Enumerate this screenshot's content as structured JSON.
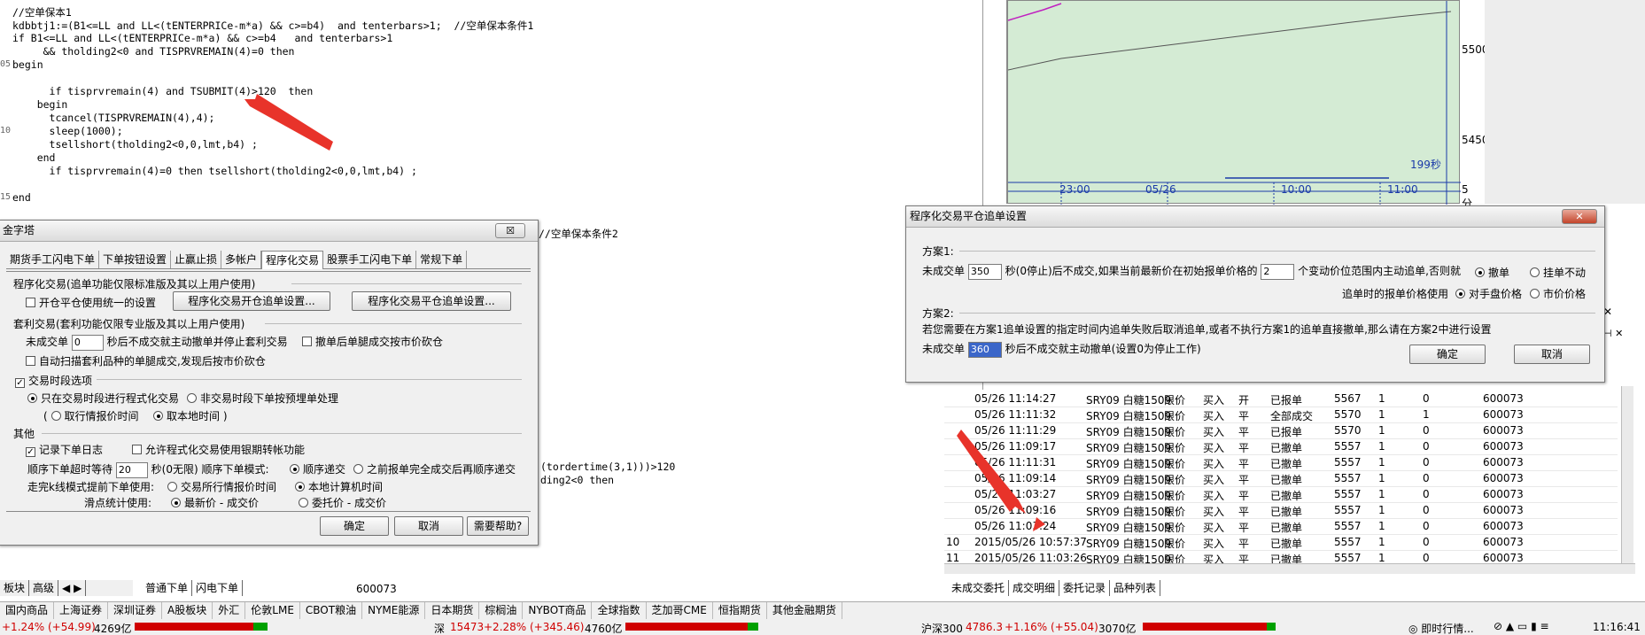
{
  "editor": {
    "lines": [
      {
        "no": "",
        "text": "//空单保本1",
        "cls": "cm"
      },
      {
        "no": "",
        "text": "kdbbtj1:=(B1<=LL and LL<(tENTERPRICe-m*a) && c>=b4)  and tenterbars>1;  //空单保本条件1",
        "cls": ""
      },
      {
        "no": "",
        "text": "if B1<=LL and LL<(tENTERPRICe-m*a) && c>=b4   and tenterbars>1",
        "cls": ""
      },
      {
        "no": "",
        "text": "     && tholding2<0 and TISPRVREMAIN(4)=0 then",
        "cls": ""
      },
      {
        "no": "05",
        "text": "begin",
        "cls": ""
      },
      {
        "no": "",
        "text": "",
        "cls": ""
      },
      {
        "no": "",
        "text": "      if tisprvremain(4) and TSUBMIT(4)>120  then",
        "cls": ""
      },
      {
        "no": "",
        "text": "    begin",
        "cls": ""
      },
      {
        "no": "",
        "text": "      tcancel(TISPRVREMAIN(4),4);",
        "cls": ""
      },
      {
        "no": "10",
        "text": "      sleep(1000);",
        "cls": ""
      },
      {
        "no": "",
        "text": "      tsellshort(tholding2<0,0,lmt,b4) ;",
        "cls": ""
      },
      {
        "no": "",
        "text": "    end",
        "cls": ""
      },
      {
        "no": "",
        "text": "      if tisprvremain(4)=0 then tsellshort(tholding2<0,0,lmt,b4) ;",
        "cls": ""
      },
      {
        "no": "",
        "text": "",
        "cls": ""
      },
      {
        "no": "15",
        "text": "end",
        "cls": ""
      }
    ],
    "fragment1": "//空单保本条件2",
    "fragment2": "(tordertime(3,1)))>120",
    "fragment3": "ding2<0 then"
  },
  "chart": {
    "y_labels": [
      "5500",
      "5450"
    ],
    "x_labels": [
      "23:00",
      "05/26",
      "10:00",
      "11:00"
    ],
    "period": "5分",
    "countdown": "199秒"
  },
  "dialog1": {
    "title": "金字塔",
    "close": "☒",
    "tabs": [
      "期货手工闪电下单",
      "下单按钮设置",
      "止赢止损",
      "多帐户",
      "程序化交易",
      "股票手工闪电下单",
      "常规下单"
    ],
    "active_tab": 4,
    "s1_title": "程序化交易(追单功能仅限标准版及其以上用户使用)",
    "s1_chk": "开仓平仓使用统一的设置",
    "s1_btn1": "程序化交易开仓追单设置...",
    "s1_btn2": "程序化交易平仓追单设置...",
    "s2_title": "套利交易(套利功能仅限专业版及其以上用户使用)",
    "s2_pre": "未成交单",
    "s2_val": "0",
    "s2_post": "秒后不成交就主动撤单并停止套利交易",
    "s2_chk2": "撤单后单腿成交按市价砍仓",
    "s2_chk3": "自动扫描套利品种的单腿成交,发现后按市价砍仓",
    "s3_chk": "交易时段选项",
    "s3_r1": "只在交易时段进行程式化交易",
    "s3_r2": "非交易时段下单按预埋单处理",
    "s3_r3": "取行情报价时间",
    "s3_r4": "取本地时间",
    "s4_title": "其他",
    "s4_chk1": "记录下单日志",
    "s4_chk2": "允许程式化交易使用银期转帐功能",
    "s4_wait_pre": "顺序下单超时等待",
    "s4_wait_val": "20",
    "s4_wait_post": "秒(0无限) 顺序下单模式:",
    "s4_mode1": "顺序递交",
    "s4_mode2": "之前报单完全成交后再顺序递交",
    "s4_adv_pre": "走完k线模式提前下单使用:",
    "s4_adv1": "交易所行情报价时间",
    "s4_adv2": "本地计算机时间",
    "s4_slip_pre": "滑点统计使用:",
    "s4_slip1": "最新价 - 成交价",
    "s4_slip2": "委托价 - 成交价",
    "ok": "确定",
    "cancel": "取消",
    "help": "需要帮助?"
  },
  "dialog2": {
    "title": "程序化交易平仓追单设置",
    "close": "✕",
    "p1_label": "方案1:",
    "p1_pre": "未成交单",
    "p1_val": "350",
    "p1_mid": "秒(0停止)后不成交,如果当前最新价在初始报单价格的",
    "p1_val2": "2",
    "p1_post": "个变动价位范围内主动追单,否则就",
    "p1_r1": "撤单",
    "p1_r2": "挂单不动",
    "p1_line2": "追单时的报单价格使用",
    "p1_r3": "对手盘价格",
    "p1_r4": "市价价格",
    "p2_label": "方案2:",
    "p2_desc": "若您需要在方案1追单设置的指定时间内追单失败后取消追单,或者不执行方案1的追单直接撤单,那么请在方案2中进行设置",
    "p2_pre": "未成交单",
    "p2_val": "360",
    "p2_post": "秒后不成交就主动撤单(设置0为停止工作)",
    "ok": "确定",
    "cancel": "取消"
  },
  "orders": [
    {
      "n": "",
      "time": "05/26 11:14:27",
      "contract": "SRY09 白糖1509",
      "type": "限价",
      "dir": "买入",
      "oc": "开",
      "status": "已报单",
      "price": "5567",
      "qty": "1",
      "filled": "0",
      "acct": "600073"
    },
    {
      "n": "",
      "time": "05/26 11:11:32",
      "contract": "SRY09 白糖1509",
      "type": "限价",
      "dir": "买入",
      "oc": "平",
      "status": "全部成交",
      "price": "5570",
      "qty": "1",
      "filled": "1",
      "acct": "600073"
    },
    {
      "n": "",
      "time": "05/26 11:11:29",
      "contract": "SRY09 白糖1509",
      "type": "限价",
      "dir": "买入",
      "oc": "平",
      "status": "已报单",
      "price": "5570",
      "qty": "1",
      "filled": "0",
      "acct": "600073"
    },
    {
      "n": "",
      "time": "05/26 11:09:17",
      "contract": "SRY09 白糖1509",
      "type": "限价",
      "dir": "买入",
      "oc": "平",
      "status": "已撤单",
      "price": "5557",
      "qty": "1",
      "filled": "0",
      "acct": "600073"
    },
    {
      "n": "",
      "time": "05/26 11:11:31",
      "contract": "SRY09 白糖1509",
      "type": "限价",
      "dir": "买入",
      "oc": "平",
      "status": "已撤单",
      "price": "5557",
      "qty": "1",
      "filled": "0",
      "acct": "600073"
    },
    {
      "n": "",
      "time": "05/26 11:09:14",
      "contract": "SRY09 白糖1509",
      "type": "限价",
      "dir": "买入",
      "oc": "平",
      "status": "已撤单",
      "price": "5557",
      "qty": "1",
      "filled": "0",
      "acct": "600073"
    },
    {
      "n": "",
      "time": "05/26 11:03:27",
      "contract": "SRY09 白糖1509",
      "type": "限价",
      "dir": "买入",
      "oc": "平",
      "status": "已撤单",
      "price": "5557",
      "qty": "1",
      "filled": "0",
      "acct": "600073"
    },
    {
      "n": "",
      "time": "05/26 11:09:16",
      "contract": "SRY09 白糖1509",
      "type": "限价",
      "dir": "买入",
      "oc": "平",
      "status": "已撤单",
      "price": "5557",
      "qty": "1",
      "filled": "0",
      "acct": "600073"
    },
    {
      "n": "",
      "time": "05/26 11:03:24",
      "contract": "SRY09 白糖1509",
      "type": "限价",
      "dir": "买入",
      "oc": "平",
      "status": "已撤单",
      "price": "5557",
      "qty": "1",
      "filled": "0",
      "acct": "600073"
    },
    {
      "n": "10",
      "time": "2015/05/26 10:57:37",
      "contract": "SRY09 白糖1509",
      "type": "限价",
      "dir": "买入",
      "oc": "平",
      "status": "已撤单",
      "price": "5557",
      "qty": "1",
      "filled": "0",
      "acct": "600073"
    },
    {
      "n": "11",
      "time": "2015/05/26 11:03:26",
      "contract": "SRY09 白糖1509",
      "type": "限价",
      "dir": "买入",
      "oc": "平",
      "status": "已撤单",
      "price": "5557",
      "qty": "1",
      "filled": "0",
      "acct": "600073"
    }
  ],
  "left_tabs": [
    "板块",
    "高级"
  ],
  "order_tabs": [
    "普通下单",
    "闪电下单"
  ],
  "code_label": "600073",
  "bottom_tabs": [
    "未成交委托",
    "成交明细",
    "委托记录",
    "品种列表"
  ],
  "market_tabs": [
    "国内商品",
    "上海证券",
    "深圳证券",
    "A股板块",
    "外汇",
    "伦敦LME",
    "CBOT粮油",
    "NYME能源",
    "日本期货",
    "棕榈油",
    "NYBOT商品",
    "全球指数",
    "芝加哥CME",
    "恒指期货",
    "其他金融期货"
  ],
  "status": {
    "s1_change": "+1.24% (+54.99)",
    "s1_amount": "4269亿",
    "s2_name": "深",
    "s2_value": "15473",
    "s2_change": "+2.28% (+345.46)",
    "s2_amount": "4760亿",
    "s3_name": "沪深300",
    "s3_value": "4786.3",
    "s3_change": "+1.16% (+55.04)",
    "s3_amount": "3070亿",
    "realtime": "即时行情...",
    "clock": "11:16:41"
  }
}
